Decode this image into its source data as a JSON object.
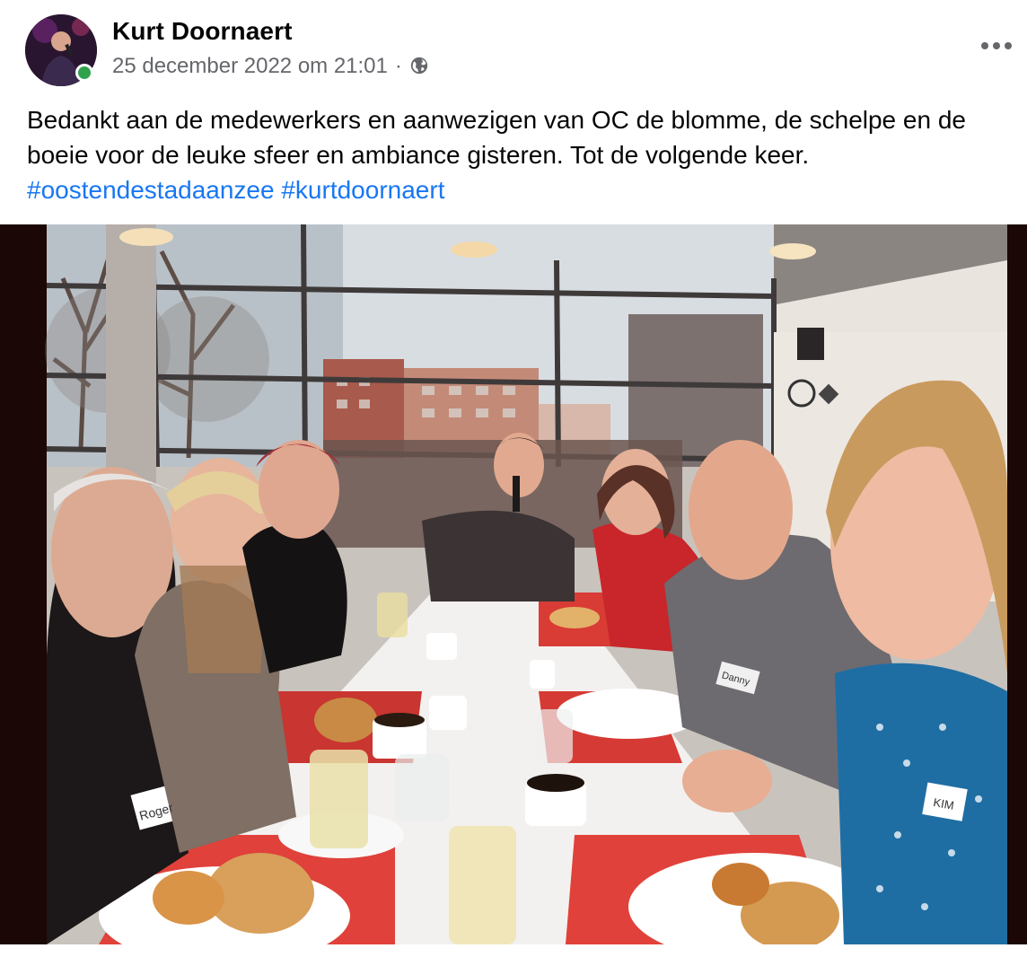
{
  "post": {
    "author": "Kurt Doornaert",
    "timestamp": "25 december 2022 om 21:01",
    "separator": "·",
    "privacy_icon": "globe-icon",
    "text": "Bedankt aan de medewerkers en aanwezigen van OC de blomme, de schelpe en de boeie voor de leuke sfeer en ambiance gisteren. Tot de volgende keer.",
    "hashtags": [
      "#oostendestadaanzee",
      "#kurtdoornaert"
    ],
    "more_icon": "more-options-icon",
    "online_status": "online"
  },
  "photo": {
    "name_tags": [
      "Roger",
      "Danny",
      "KIM"
    ]
  },
  "colors": {
    "link": "#1877f2",
    "secondary_text": "#65676b",
    "online": "#31a24c"
  }
}
